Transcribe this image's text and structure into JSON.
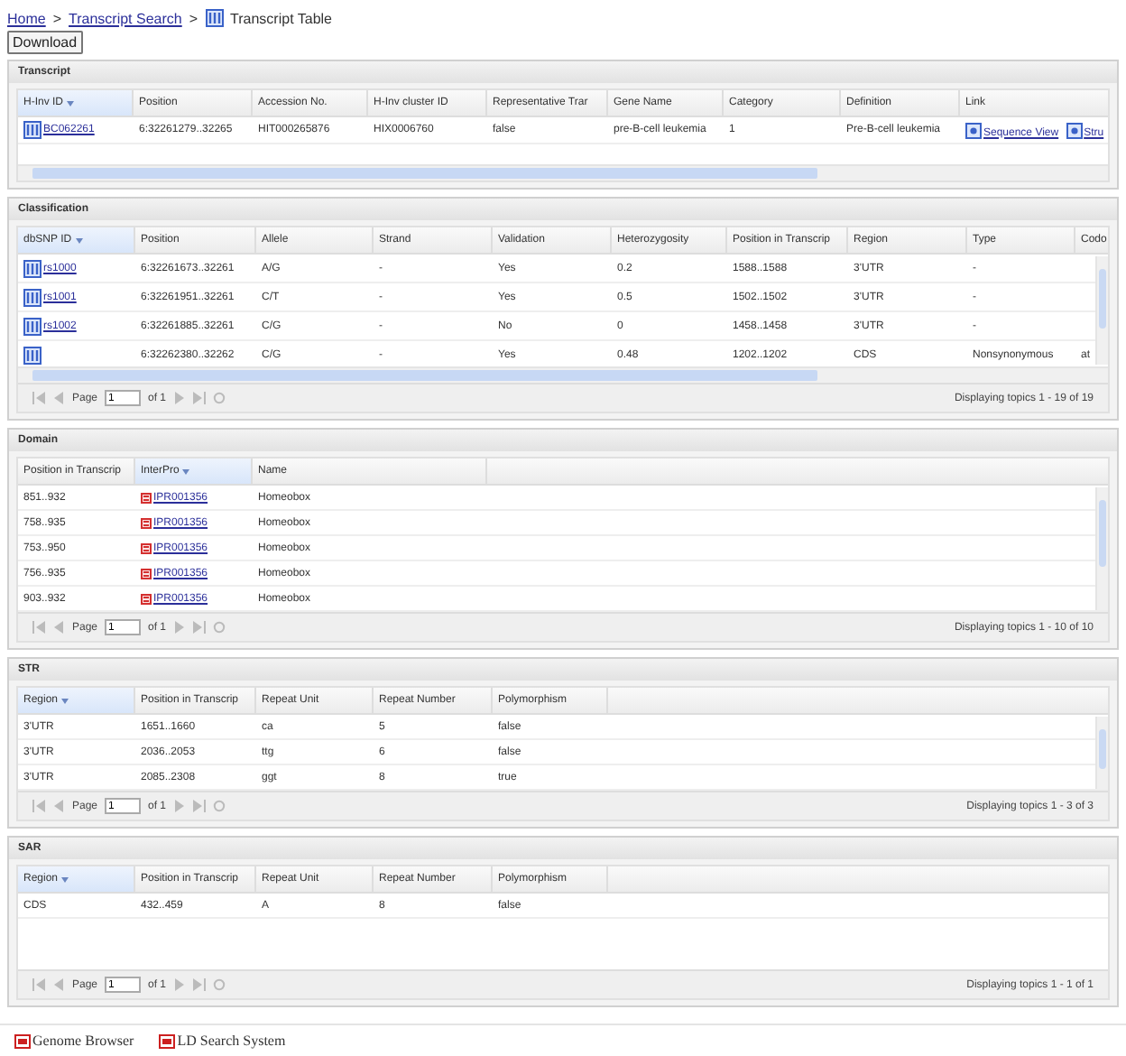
{
  "breadcrumb": [
    {
      "text": "Home",
      "kind": "link"
    },
    {
      "text": ">",
      "kind": "sep"
    },
    {
      "text": "Transcript Search",
      "kind": "link"
    },
    {
      "text": ">",
      "kind": "sep"
    },
    {
      "text": "Transcript Table",
      "kind": "current"
    }
  ],
  "download_button": "Download",
  "panels": [
    {
      "title": "Transcript",
      "horizontal_scroll": true,
      "columns": [
        {
          "label": "H-Inv ID",
          "sorted": true
        },
        {
          "label": "Position",
          "sorted": false
        },
        {
          "label": "Accession No.",
          "sorted": false
        },
        {
          "label": "H-Inv cluster ID",
          "sorted": false
        },
        {
          "label": "Representative Trar",
          "sorted": false
        },
        {
          "label": "Gene Name",
          "sorted": false
        },
        {
          "label": "Category",
          "sorted": false
        },
        {
          "label": "Definition",
          "sorted": false
        },
        {
          "label": "Link",
          "sorted": false
        }
      ],
      "rows": [
        [
          {
            "kind": "record-link",
            "text": "BC062261"
          },
          "6:32261279..32265",
          "HIT000265876",
          "HIX0006760",
          "false",
          "pre-B-cell leukemia",
          "1",
          "Pre-B-cell leukemia",
          {
            "kind": "view-links",
            "links": [
              "Sequence View",
              "Stru"
            ]
          }
        ]
      ]
    },
    {
      "title": "Classification",
      "horizontal_scroll": true,
      "vertical_scroll": true,
      "columns": [
        {
          "label": "dbSNP ID",
          "sorted": true
        },
        {
          "label": "Position",
          "sorted": false
        },
        {
          "label": "Allele",
          "sorted": false
        },
        {
          "label": "Strand",
          "sorted": false
        },
        {
          "label": "Validation",
          "sorted": false
        },
        {
          "label": "Heterozygosity",
          "sorted": false
        },
        {
          "label": "Position in Transcrip",
          "sorted": false
        },
        {
          "label": "Region",
          "sorted": false
        },
        {
          "label": "Type",
          "sorted": false
        },
        {
          "label": "Codo",
          "sorted": false
        }
      ],
      "rows": [
        [
          {
            "kind": "record-link",
            "text": "rs1000"
          },
          "6:32261673..32261",
          "A/G",
          "-",
          "Yes",
          "0.2",
          "1588..1588",
          "3'UTR",
          "-",
          ""
        ],
        [
          {
            "kind": "record-link",
            "text": "rs1001"
          },
          "6:32261951..32261",
          "C/T",
          "-",
          "Yes",
          "0.5",
          "1502..1502",
          "3'UTR",
          "-",
          ""
        ],
        [
          {
            "kind": "record-link",
            "text": "rs1002"
          },
          "6:32261885..32261",
          "C/G",
          "-",
          "No",
          "0",
          "1458..1458",
          "3'UTR",
          "-",
          ""
        ],
        [
          {
            "kind": "record-link",
            "text": ""
          },
          "6:32262380..32262",
          "C/G",
          "-",
          "Yes",
          "0.48",
          "1202..1202",
          "CDS",
          "Nonsynonymous",
          "at"
        ]
      ],
      "pager": {
        "page_label": "Page",
        "page": "1",
        "of": "of 1",
        "status": "Displaying topics 1 - 19 of 19"
      }
    },
    {
      "title": "Domain",
      "vertical_scroll": true,
      "columns": [
        {
          "label": "Position in Transcrip",
          "sorted": false
        },
        {
          "label": "InterPro",
          "sorted": true
        },
        {
          "label": "Name",
          "sorted": false
        }
      ],
      "rows": [
        [
          "851..932",
          {
            "kind": "domain-link",
            "text": "IPR001356"
          },
          "Homeobox"
        ],
        [
          "758..935",
          {
            "kind": "domain-link",
            "text": "IPR001356"
          },
          "Homeobox"
        ],
        [
          "753..950",
          {
            "kind": "domain-link",
            "text": "IPR001356"
          },
          "Homeobox"
        ],
        [
          "756..935",
          {
            "kind": "domain-link",
            "text": "IPR001356"
          },
          "Homeobox"
        ],
        [
          "903..932",
          {
            "kind": "domain-link",
            "text": "IPR001356"
          },
          "Homeobox"
        ]
      ],
      "pager": {
        "page_label": "Page",
        "page": "1",
        "of": "of 1",
        "status": "Displaying topics 1 - 10 of 10"
      }
    },
    {
      "title": "STR",
      "vertical_scroll": true,
      "columns": [
        {
          "label": "Region",
          "sorted": true
        },
        {
          "label": "Position in Transcrip",
          "sorted": false
        },
        {
          "label": "Repeat Unit",
          "sorted": false
        },
        {
          "label": "Repeat Number",
          "sorted": false
        },
        {
          "label": "Polymorphism",
          "sorted": false
        }
      ],
      "rows": [
        [
          "3'UTR",
          "1651..1660",
          "ca",
          "5",
          "false"
        ],
        [
          "3'UTR",
          "2036..2053",
          "ttg",
          "6",
          "false"
        ],
        [
          "3'UTR",
          "2085..2308",
          "ggt",
          "8",
          "true"
        ]
      ],
      "pager": {
        "page_label": "Page",
        "page": "1",
        "of": "of 1",
        "status": "Displaying topics 1 - 3 of 3"
      }
    },
    {
      "title": "SAR",
      "columns": [
        {
          "label": "Region",
          "sorted": true
        },
        {
          "label": "Position in Transcrip",
          "sorted": false
        },
        {
          "label": "Repeat Unit",
          "sorted": false
        },
        {
          "label": "Repeat Number",
          "sorted": false
        },
        {
          "label": "Polymorphism",
          "sorted": false
        }
      ],
      "rows": [
        [
          "CDS",
          "432..459",
          "A",
          "8",
          "false"
        ]
      ],
      "pager": {
        "page_label": "Page",
        "page": "1",
        "of": "of 1",
        "status": "Displaying topics 1 - 1 of 1"
      }
    }
  ],
  "footer_links": [
    "Genome Browser",
    "LD Search System"
  ]
}
